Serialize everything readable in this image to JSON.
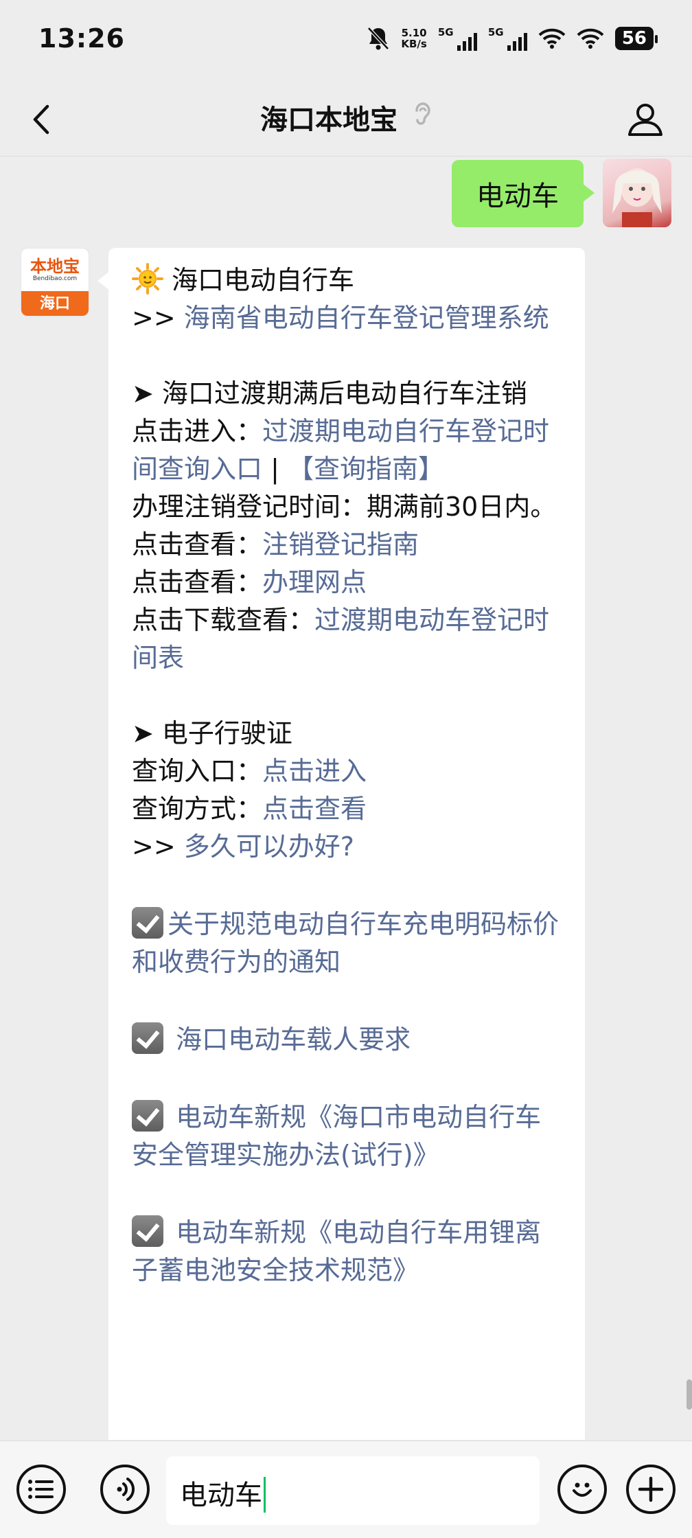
{
  "status_bar": {
    "time": "13:26",
    "net_speed_value": "5.10",
    "net_speed_unit": "KB/s",
    "sim1_label": "5G",
    "sim2_label": "5G",
    "battery": "56"
  },
  "nav": {
    "title": "海口本地宝"
  },
  "user_message": {
    "text": "电动车"
  },
  "bot_avatar": {
    "brand": "本地宝",
    "domain": "Bendibao.com",
    "city": "海口"
  },
  "bot_message": {
    "title": "海口电动自行车",
    "prefix_arrow": ">>",
    "registration_link": "海南省电动自行车登记管理系统",
    "section1_title": "➤ 海口过渡期满后电动自行车注销",
    "click_enter_label": "点击进入：",
    "transition_query_link": "过渡期电动自行车登记时间查询入口",
    "separator": " | ",
    "query_guide_link": "【查询指南】",
    "deregister_time": "办理注销登记时间：期满前30日内。",
    "click_view_label": "点击查看：",
    "deregister_guide_link": "注销登记指南",
    "outlets_link": "办理网点",
    "click_download_label": "点击下载查看：",
    "schedule_link": "过渡期电动车登记时间表",
    "section2_title": "➤ 电子行驶证",
    "query_entry_label": "查询入口：",
    "query_entry_link": "点击进入",
    "query_method_label": "查询方式：",
    "query_method_link": "点击查看",
    "how_long_link": "多久可以办好?",
    "items": [
      "关于规范电动自行车充电明码标价和收费行为的通知",
      "海口电动车载人要求",
      "电动车新规《海口市电动自行车安全管理实施办法(试行)》",
      "电动车新规《电动自行车用锂离子蓄电池安全技术规范》"
    ]
  },
  "input_bar": {
    "value": "电动车"
  },
  "colors": {
    "user_bubble": "#95ec69",
    "link": "#576b95",
    "background": "#ededed"
  }
}
